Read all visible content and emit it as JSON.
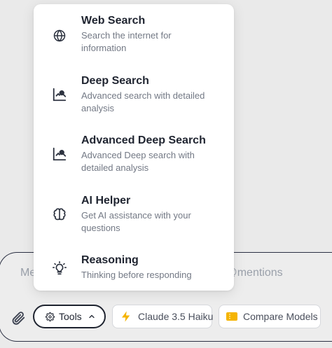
{
  "composer": {
    "placeholder": "Message AI Chat... (use /commands and @mentions"
  },
  "toolbar": {
    "tools_label": "Tools",
    "model_label": "Claude 3.5 Haiku",
    "compare_label": "Compare Models"
  },
  "menu": {
    "items": [
      {
        "title": "Web Search",
        "desc_line1": "Search the internet for",
        "desc_line2": "information",
        "icon": "globe-icon"
      },
      {
        "title": "Deep Search",
        "desc_line1": "Advanced search with detailed",
        "desc_line2": "analysis",
        "icon": "chart-search-icon"
      },
      {
        "title": "Advanced Deep Search",
        "desc_line1": "Advanced Deep search with",
        "desc_line2": "detailed analysis",
        "icon": "chart-search-icon"
      },
      {
        "title": "AI Helper",
        "desc_line1": "Get AI assistance with your",
        "desc_line2": "questions",
        "icon": "brain-icon"
      },
      {
        "title": "Reasoning",
        "desc_line1": "Thinking before responding",
        "desc_line2": "",
        "icon": "lightbulb-icon"
      }
    ]
  },
  "colors": {
    "background": "#eaeaea",
    "menu_bg": "#ffffff",
    "border_dark": "#1f2430",
    "bolt": "#f5b400",
    "ticket": "#f5b400"
  }
}
